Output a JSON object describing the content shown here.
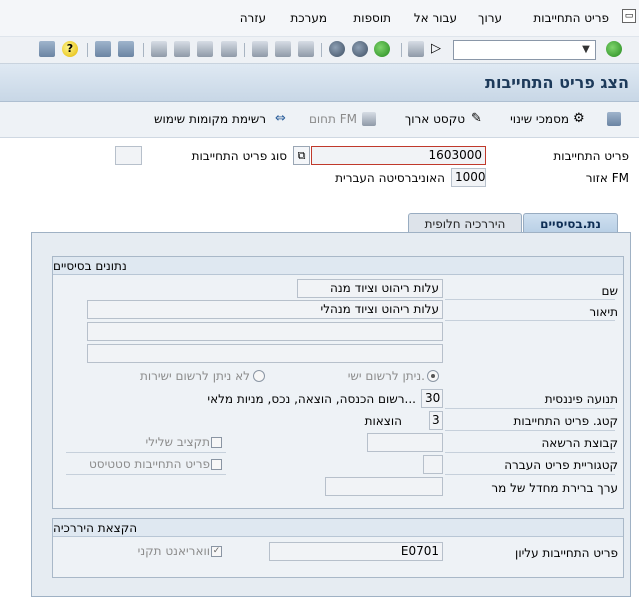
{
  "menu": {
    "items": [
      "פריט התחייבות",
      "ערוך",
      "עבור אל",
      "תוספות",
      "מערכת",
      "עזרה"
    ]
  },
  "toolbar": {
    "command_value": "",
    "icons": [
      "enter-icon",
      "save-icon",
      "back-icon",
      "exit-icon",
      "cancel-icon",
      "print-icon",
      "find-icon",
      "find-next-icon",
      "first-page-icon",
      "previous-page-icon",
      "next-page-icon",
      "last-page-icon",
      "create-session-icon",
      "shortcut-icon",
      "help-icon",
      "customize-layout-icon"
    ]
  },
  "title": "הצג פריט התחייבות",
  "app_toolbar": {
    "docs": "מסמכי שינוי",
    "long_text": "טקסט ארוך",
    "fm_area": "תחום FM",
    "usage_list": "רשימת מקומות שימוש"
  },
  "header": {
    "commitment_item_label": "פריט התחייבות",
    "commitment_item_value": "1603000",
    "item_type_label": "סוג פריט התחייבות",
    "item_type_value": "",
    "fm_area_label": "אזור FM",
    "fm_area_value": "1000",
    "fm_area_desc": "האוניברסיטה העברית"
  },
  "tabs": [
    {
      "label": "נת.בסיסיים",
      "active": true
    },
    {
      "label": "היררכיה חלופית",
      "active": false
    }
  ],
  "basic": {
    "title": "נתונים בסיסיים",
    "name_label": "שם",
    "name_value": "עלות ריהוט וציוד מנה",
    "desc_label": "תיאור",
    "desc_value": "עלות ריהוט וציוד מנהלי",
    "desc_line2": "",
    "desc_line3": "",
    "radio_direct": "ניתן לרשום ישי.",
    "radio_no_direct": "לא ניתן לרשום ישירות",
    "fin_trans_label": "תנועה פיננסית",
    "fin_trans_value": "30",
    "fin_trans_desc": "רשום הכנסה, הוצאה, נכס, מניות מלאי...",
    "category_label": "קטג. פריט התחייבות",
    "category_value": "3",
    "category_desc": "הוצאות",
    "auth_group_label": "קבוצת הרשאה",
    "auth_group_value": "",
    "negative_budget": "תקציב שלילי",
    "transfer_cat_label": "קטגוריית פריט העברה",
    "transfer_cat_value": "",
    "statistical_item": "פריט התחייבות סטטיסט",
    "default_value_label": "ערך ברירת מחדל של מר",
    "default_value_value": ""
  },
  "hierarchy": {
    "title": "הקצאת היררכיה",
    "superior_label": "פריט התחייבות עליון",
    "superior_value": "E0701",
    "standard_variant": "וואריאנט תקני",
    "standard_variant_checked": true
  }
}
